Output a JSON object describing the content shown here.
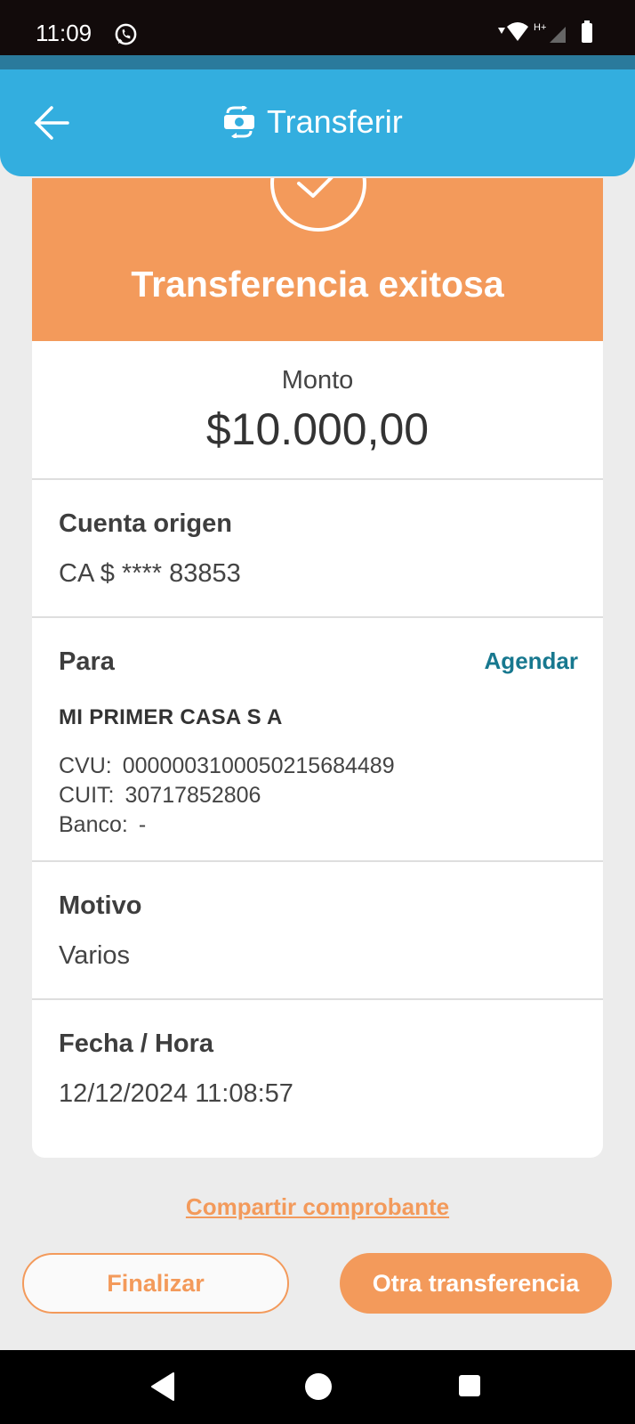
{
  "status_bar": {
    "time": "11:09",
    "icons": [
      "whatsapp-icon",
      "wifi-icon",
      "signal-icon",
      "battery-icon"
    ],
    "network_label": "H+"
  },
  "app_bar": {
    "title": "Transferir",
    "back_icon": "arrow-left-icon",
    "title_icon": "money-transfer-icon"
  },
  "banner": {
    "title": "Transferencia exitosa",
    "icon": "check-circle-icon"
  },
  "amount": {
    "label": "Monto",
    "value": "$10.000,00"
  },
  "origin": {
    "label": "Cuenta origen",
    "value": "CA $ **** 83853"
  },
  "recipient": {
    "label": "Para",
    "schedule_link": "Agendar",
    "name": "MI PRIMER CASA S A",
    "cvu_label": "CVU:",
    "cvu_value": "0000003100050215684489",
    "cuit_label": "CUIT:",
    "cuit_value": "30717852806",
    "bank_label": "Banco:",
    "bank_value": "-"
  },
  "reason": {
    "label": "Motivo",
    "value": "Varios"
  },
  "datetime": {
    "label": "Fecha / Hora",
    "value": "12/12/2024 11:08:57"
  },
  "actions": {
    "share_link": "Compartir comprobante",
    "finish_label": "Finalizar",
    "another_label": "Otra transferencia"
  },
  "colors": {
    "app_bar": "#33aedf",
    "accent_orange": "#f39a5b",
    "link_teal": "#17788f"
  }
}
